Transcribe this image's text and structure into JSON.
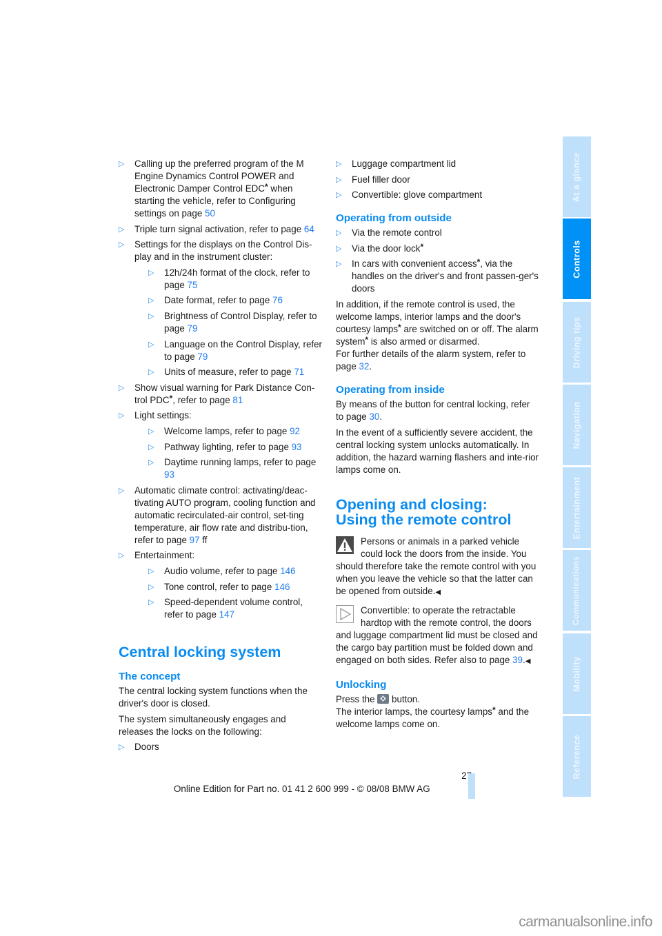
{
  "left_column": {
    "items": [
      {
        "text": "Calling up the preferred program of the M Engine Dynamics Control POWER and Electronic Damper Control EDC",
        "star": true,
        "text_after": " when starting the vehicle, refer to Configuring settings on page ",
        "page": "50"
      },
      {
        "text": "Triple turn signal activation, refer to page ",
        "page": "64"
      },
      {
        "text": "Settings for the displays on the Control Dis-play and in the instrument cluster:",
        "sub": [
          {
            "text": "12h/24h format of the clock, refer to page ",
            "page": "75"
          },
          {
            "text": "Date format, refer to page ",
            "page": "76"
          },
          {
            "text": "Brightness of Control Display, refer to page ",
            "page": "79"
          },
          {
            "text": "Language on the Control Display, refer to page ",
            "page": "79"
          },
          {
            "text": "Units of measure, refer to page ",
            "page": "71"
          }
        ]
      },
      {
        "text": "Show visual warning for Park Distance Con-trol PDC",
        "star": true,
        "text_after": ", refer to page ",
        "page": "81"
      },
      {
        "text": "Light settings:",
        "sub": [
          {
            "text": "Welcome lamps, refer to page ",
            "page": "92"
          },
          {
            "text": "Pathway lighting, refer to page ",
            "page": "93"
          },
          {
            "text": "Daytime running lamps, refer to page ",
            "page": "93"
          }
        ]
      },
      {
        "text": "Automatic climate control: activating/deac-tivating AUTO program, cooling function and automatic recirculated-air control, set-ting temperature, air flow rate and distribu-tion, refer to page ",
        "page": "97",
        "text_after": " ff"
      },
      {
        "text": "Entertainment:",
        "sub": [
          {
            "text": "Audio volume, refer to page ",
            "page": "146"
          },
          {
            "text": "Tone control, refer to page ",
            "page": "146"
          },
          {
            "text": "Speed-dependent volume control, refer to page ",
            "page": "147"
          }
        ]
      }
    ],
    "section_title": "Central locking system",
    "concept_heading": "The concept",
    "concept_p1": "The central locking system functions when the driver's door is closed.",
    "concept_p2": "The system simultaneously engages and releases the locks on the following:",
    "concept_list": [
      "Doors"
    ]
  },
  "right_column": {
    "lock_list": [
      "Luggage compartment lid",
      "Fuel filler door",
      "Convertible: glove compartment"
    ],
    "outside_heading": "Operating from outside",
    "outside_list": [
      {
        "text": "Via the remote control"
      },
      {
        "text": "Via the door lock",
        "star": true
      },
      {
        "text": "In cars with convenient access",
        "star": true,
        "text_after": ", via the handles on the driver's and front passen-ger's doors"
      }
    ],
    "outside_p1_a": "In addition, if the remote control is used, the welcome lamps, interior lamps and the door's courtesy lamps",
    "outside_p1_b": " are switched on or off. The alarm system",
    "outside_p1_c": " is also armed or disarmed.",
    "outside_p2": "For further details of the alarm system, refer to page ",
    "outside_p2_page": "32",
    "inside_heading": "Operating from inside",
    "inside_p1": "By means of the button for central locking, refer to page ",
    "inside_p1_page": "30",
    "inside_p2": "In the event of a sufficiently severe accident, the central locking system unlocks automatically. In addition, the hazard warning flashers and inte-rior lamps come on.",
    "section_title_line1": "Opening and closing:",
    "section_title_line2": "Using the remote control",
    "warning_icon": "warning-triangle-icon",
    "warning_text": "Persons or animals in a parked vehicle could lock the doors from the inside. You should therefore take the remote control with you when you leave the vehicle so that the latter can be opened from outside.",
    "note_icon": "note-arrow-icon",
    "note_text": "Convertible: to operate the retractable hardtop with the remote control, the doors and luggage compartment lid must be closed and the cargo bay partition must be folded down and engaged on both sides. Refer also to page ",
    "note_page": "39",
    "end_mark": "◀",
    "unlocking_heading": "Unlocking",
    "unlocking_p1_a": "Press the ",
    "unlocking_button_icon": "remote-unlock-button-icon",
    "unlocking_p1_b": " button.",
    "unlocking_p2_a": "The interior lamps, the courtesy lamps",
    "unlocking_p2_b": " and the welcome lamps come on."
  },
  "tabs": [
    {
      "label": "At a glance",
      "active": false
    },
    {
      "label": "Controls",
      "active": true
    },
    {
      "label": "Driving tips",
      "active": false
    },
    {
      "label": "Navigation",
      "active": false
    },
    {
      "label": "Entertainment",
      "active": false
    },
    {
      "label": "Communications",
      "active": false
    },
    {
      "label": "Mobility",
      "active": false
    },
    {
      "label": "Reference",
      "active": false
    }
  ],
  "page_number": "27",
  "footer": "Online Edition for Part no. 01 41 2 600 999 - © 08/08 BMW AG",
  "watermark": "carmanualsonline.info",
  "colors": {
    "accent": "#0a8bf0",
    "link": "#1f7bf0",
    "tab_active": "#0091f7",
    "tab_inactive": "#bfe0fb"
  }
}
